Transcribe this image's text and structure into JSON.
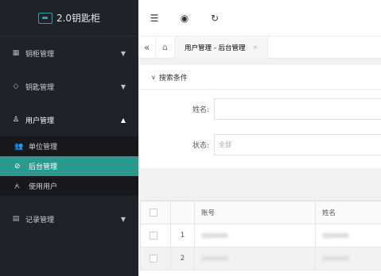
{
  "app": {
    "title": "2.0钥匙柜"
  },
  "sidebar": {
    "items": [
      {
        "label": "钥柜管理",
        "icon": "grid-icon",
        "arrow": "▼"
      },
      {
        "label": "钥匙管理",
        "icon": "tag-icon",
        "arrow": "▼"
      },
      {
        "label": "用户管理",
        "icon": "user-icon",
        "arrow": "▲",
        "open": true,
        "children": [
          {
            "label": "单位管理",
            "icon": "users-icon"
          },
          {
            "label": "后台管理",
            "icon": "shield-check-icon",
            "active": true
          },
          {
            "label": "使用用户",
            "icon": "person-icon"
          }
        ]
      },
      {
        "label": "记录管理",
        "icon": "record-icon",
        "arrow": "▼"
      }
    ]
  },
  "topbar": {
    "buttons": [
      {
        "icon": "menu-fold-icon",
        "glyph": "☰"
      },
      {
        "icon": "theme-icon",
        "glyph": "◉"
      },
      {
        "icon": "refresh-icon",
        "glyph": "↻"
      }
    ]
  },
  "tabs": {
    "prev_glyph": "«",
    "home_glyph": "⌂",
    "items": [
      {
        "label": "用户管理 - 后台管理",
        "close": "×"
      }
    ]
  },
  "search": {
    "header": "搜索条件",
    "name_label": "姓名:",
    "name_value": "",
    "status_label": "状态:",
    "status_placeholder": "全部"
  },
  "table": {
    "columns": [
      "账号",
      "姓名"
    ],
    "rows": [
      {
        "num": "1"
      },
      {
        "num": "2"
      }
    ]
  }
}
